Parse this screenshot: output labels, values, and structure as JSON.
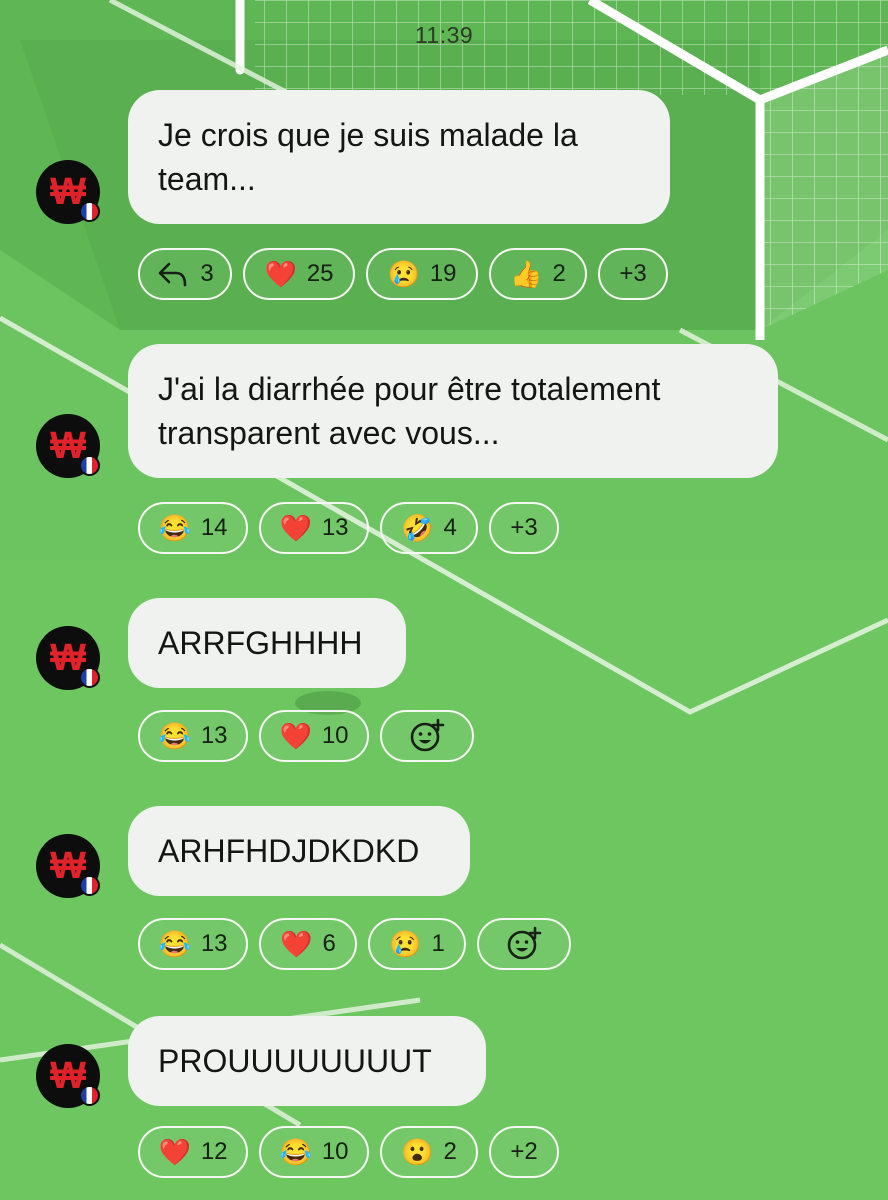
{
  "status": {
    "time": "11:39"
  },
  "colors": {
    "background": "#6cc460",
    "bubble": "#eff2ef",
    "chip_border": "#f6f8f4",
    "avatar_accent": "#e0222b"
  },
  "messages": [
    {
      "text": "Je crois que je suis malade la team...",
      "reactions": [
        {
          "icon": "reply-arrow-icon",
          "count": "3"
        },
        {
          "emoji": "❤️",
          "icon": "heart-icon",
          "count": "25"
        },
        {
          "emoji": "😢",
          "icon": "crying-face-icon",
          "count": "19"
        },
        {
          "emoji": "👍",
          "icon": "thumbs-up-icon",
          "count": "2"
        },
        {
          "count": "+3"
        }
      ]
    },
    {
      "text": "J'ai la diarrhée pour être totalement transparent avec vous...",
      "reactions": [
        {
          "emoji": "😂",
          "icon": "tears-of-joy-icon",
          "count": "14"
        },
        {
          "emoji": "❤️",
          "icon": "heart-icon",
          "count": "13"
        },
        {
          "emoji": "🤣",
          "icon": "rolling-laughing-icon",
          "count": "4"
        },
        {
          "count": "+3"
        }
      ]
    },
    {
      "text": "ARRFGHHHH",
      "reactions": [
        {
          "emoji": "😂",
          "icon": "tears-of-joy-icon",
          "count": "13"
        },
        {
          "emoji": "❤️",
          "icon": "heart-icon",
          "count": "10"
        },
        {
          "icon": "add-reaction-icon"
        }
      ]
    },
    {
      "text": "ARHFHDJDKDKD",
      "reactions": [
        {
          "emoji": "😂",
          "icon": "tears-of-joy-icon",
          "count": "13"
        },
        {
          "emoji": "❤️",
          "icon": "heart-icon",
          "count": "6"
        },
        {
          "emoji": "😢",
          "icon": "crying-face-icon",
          "count": "1"
        },
        {
          "icon": "add-reaction-icon"
        }
      ]
    },
    {
      "text": "PROUUUUUUUUT",
      "reactions": [
        {
          "emoji": "❤️",
          "icon": "heart-icon",
          "count": "12"
        },
        {
          "emoji": "😂",
          "icon": "tears-of-joy-icon",
          "count": "10"
        },
        {
          "emoji": "😮",
          "icon": "surprised-face-icon",
          "count": "2"
        },
        {
          "count": "+2"
        }
      ]
    }
  ]
}
